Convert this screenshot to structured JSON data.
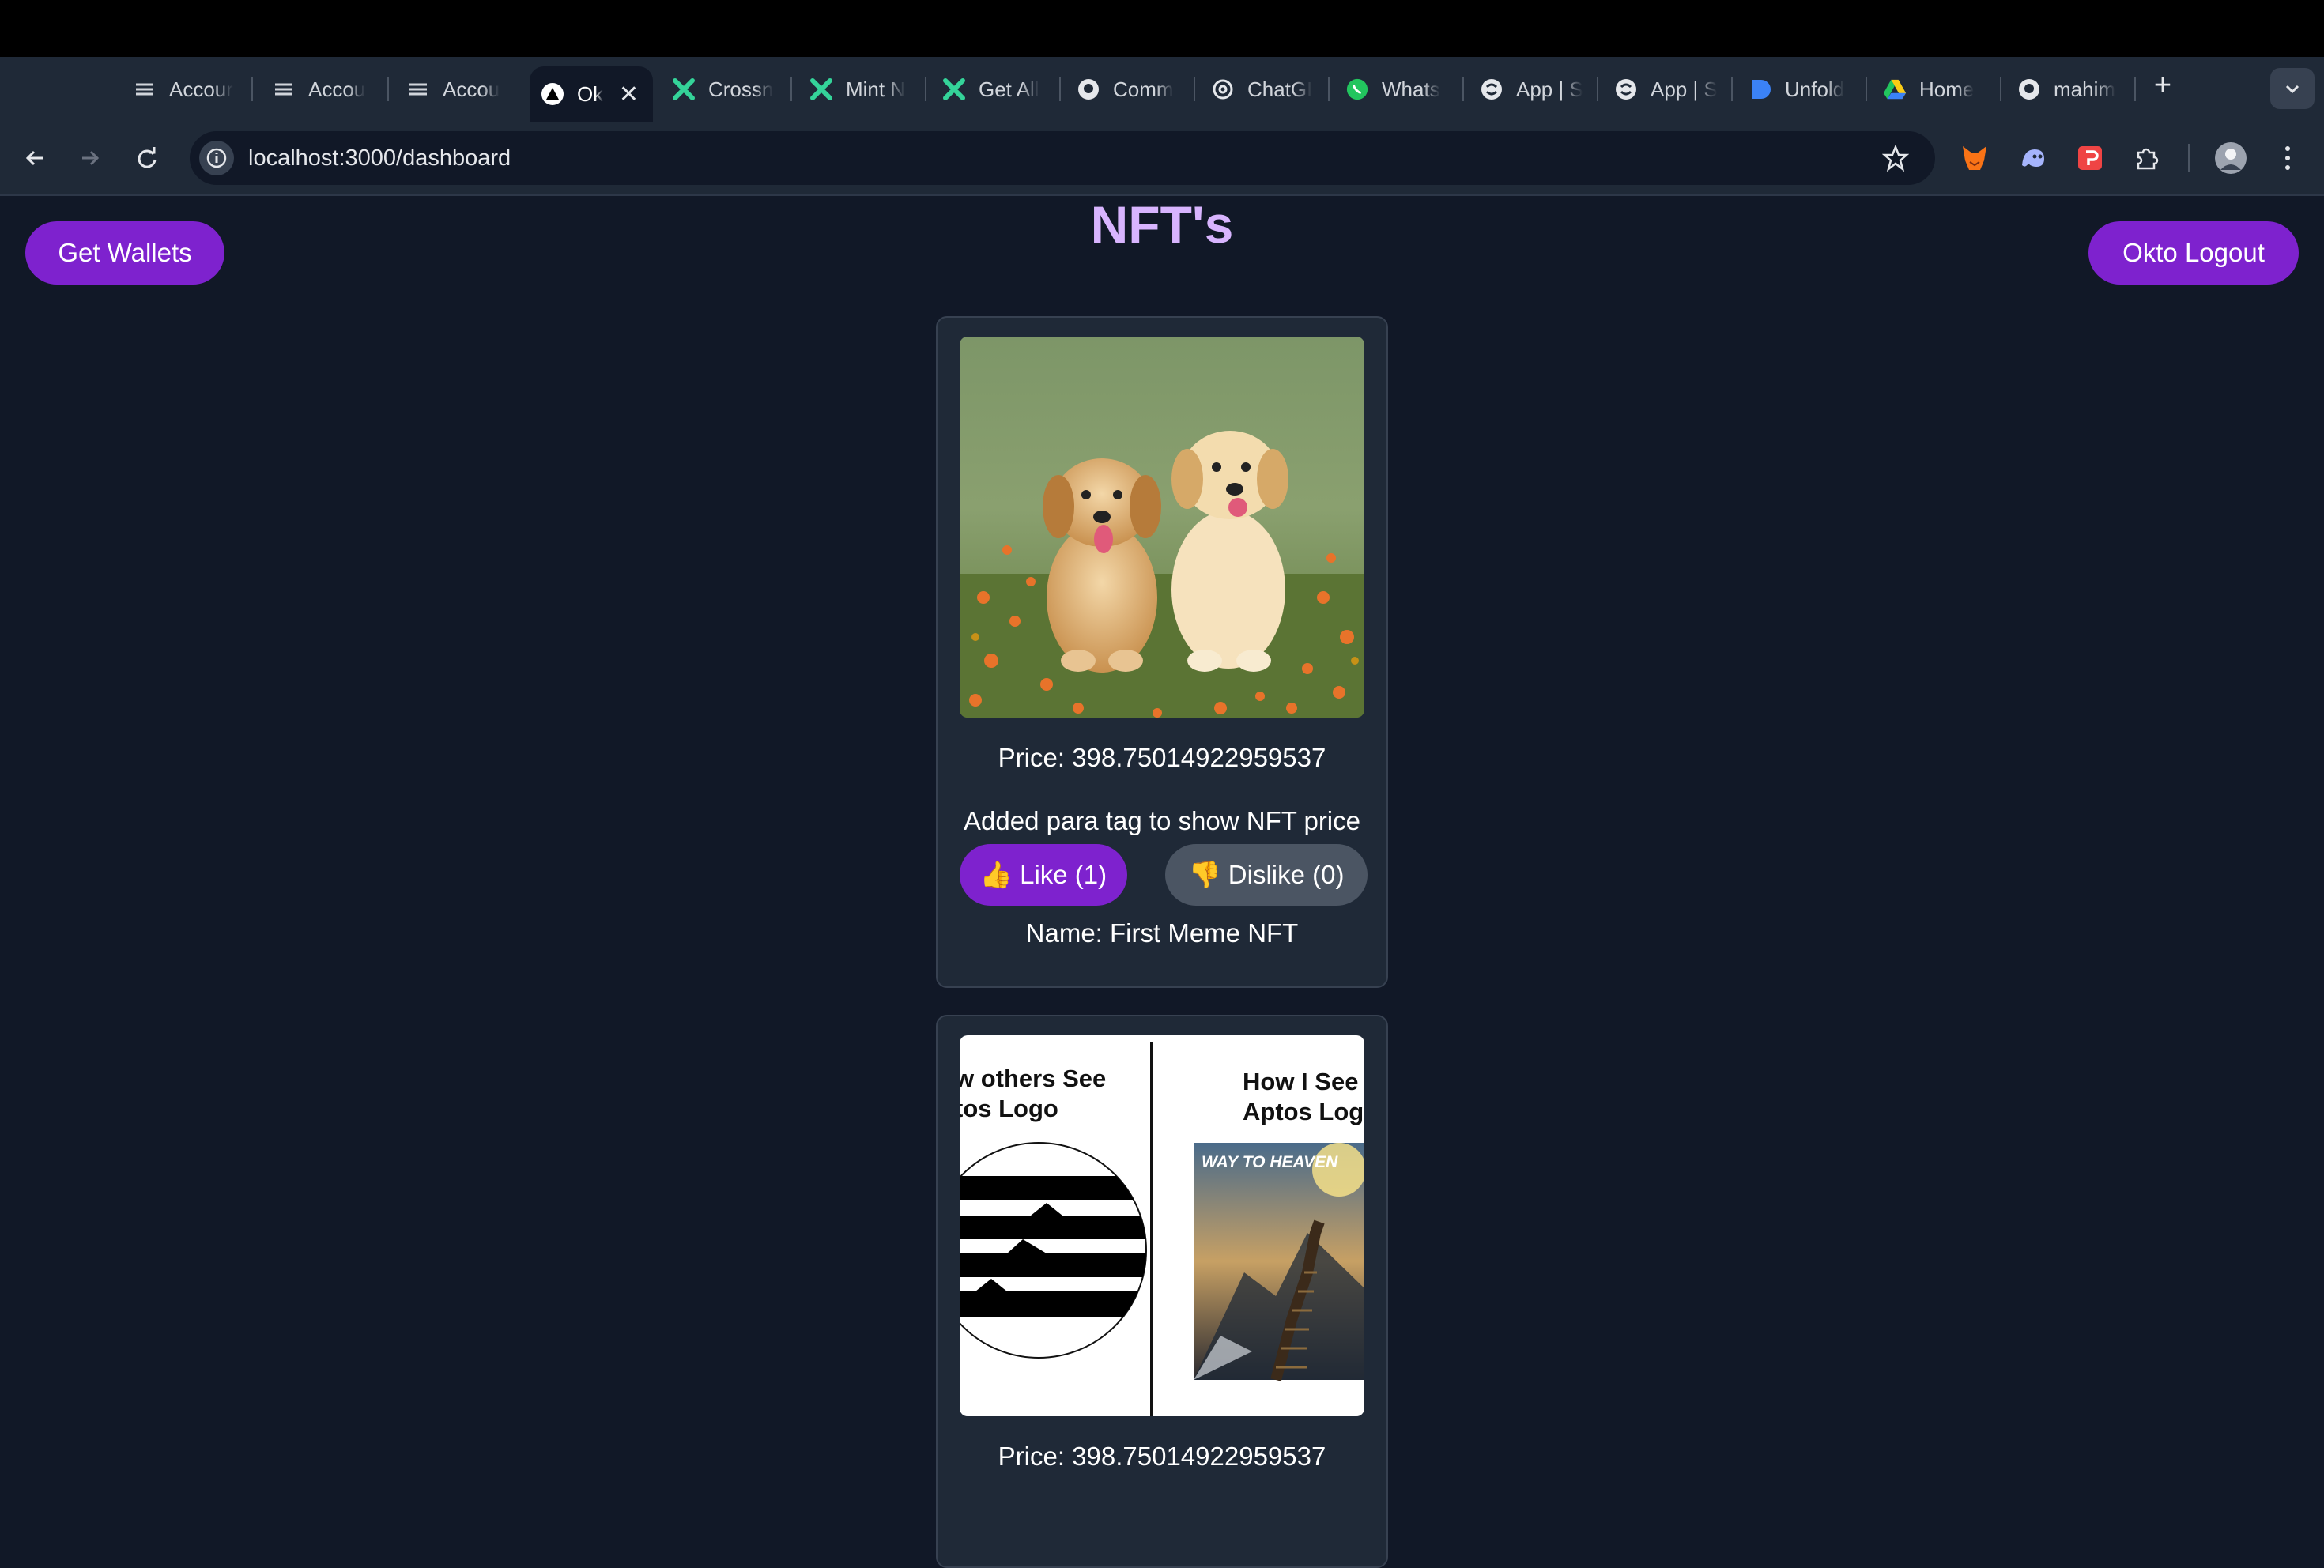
{
  "browser": {
    "tabs": [
      {
        "label": "Accour",
        "icon": "layers-icon"
      },
      {
        "label": "Accou",
        "icon": "layers-icon"
      },
      {
        "label": "Accou",
        "icon": "layers-icon"
      },
      {
        "label": "Ok",
        "icon": "triangle-logo-icon",
        "active": true
      },
      {
        "label": "Crossn",
        "icon": "crossmint-icon"
      },
      {
        "label": "Mint N",
        "icon": "crossmint-icon"
      },
      {
        "label": "Get All",
        "icon": "crossmint-icon"
      },
      {
        "label": "Comm",
        "icon": "github-icon"
      },
      {
        "label": "ChatGI",
        "icon": "openai-icon"
      },
      {
        "label": "Whats",
        "icon": "whatsapp-icon"
      },
      {
        "label": "App | S",
        "icon": "swirl-icon"
      },
      {
        "label": "App | S",
        "icon": "swirl-icon"
      },
      {
        "label": "Unfold",
        "icon": "doc-shape-icon"
      },
      {
        "label": "Home",
        "icon": "google-drive-icon"
      },
      {
        "label": "mahim",
        "icon": "github-icon"
      }
    ],
    "close_tab": "✕",
    "new_tab": "+",
    "url": "localhost:3000/dashboard"
  },
  "page": {
    "title": "NFT's",
    "get_wallets_label": "Get Wallets",
    "logout_label": "Okto Logout"
  },
  "nfts": [
    {
      "image": "two-golden-retriever-puppies",
      "price": "Price: 398.75014922959537",
      "description": "Added para tag to show NFT price",
      "like_label": "👍 Like (1)",
      "dislike_label": "👎 Dislike (0)",
      "name": "Name: First Meme NFT"
    },
    {
      "image": "aptos-logo-meme",
      "meme_left": [
        "w others See",
        "tos Logo"
      ],
      "meme_right": [
        "How I See",
        "Aptos Logo"
      ],
      "meme_poster": "WAY TO HEAVEN",
      "price": "Price: 398.75014922959537"
    }
  ],
  "colors": {
    "background": "#111827",
    "card": "#1f2937",
    "accent": "#7e22ce",
    "title": "#d8b4fe"
  }
}
